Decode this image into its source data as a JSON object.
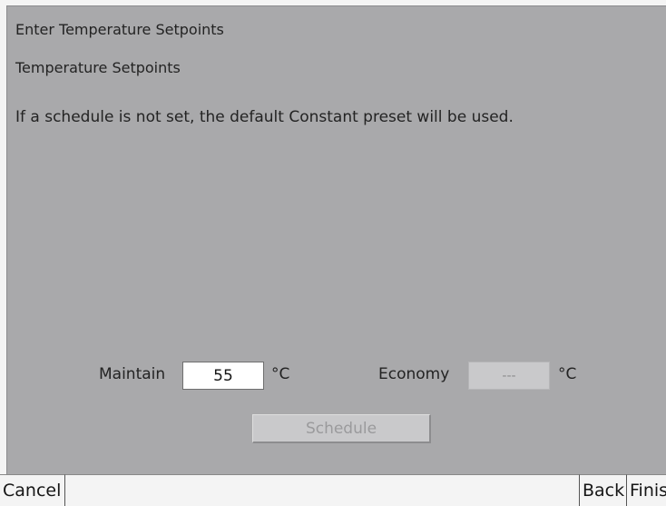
{
  "header": {
    "wizard_title": "Enter Temperature Setpoints",
    "section_title": "Temperature Setpoints",
    "info_text": "If a schedule is not set, the default Constant preset will be used."
  },
  "setpoints": {
    "maintain_label": "Maintain",
    "maintain_value": "55",
    "maintain_unit": "°C",
    "economy_label": "Economy",
    "economy_value": "---",
    "economy_unit": "°C"
  },
  "schedule_button": {
    "label": "Schedule",
    "enabled": false
  },
  "footer": {
    "cancel_label": "Cancel",
    "back_label": "Back",
    "finish_label": "Finis"
  },
  "colors": {
    "panel_background": "#a9a9ab",
    "bar_background": "#f4f4f4",
    "disabled_text": "#9a9a9c"
  }
}
